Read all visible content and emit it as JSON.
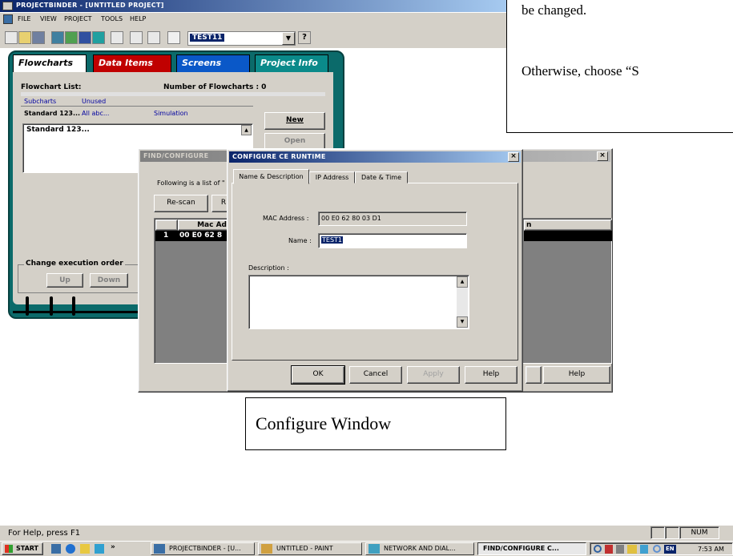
{
  "app": {
    "title": "ProjectBinder - [Untitled Project]",
    "menu": [
      "File",
      "View",
      "Project",
      "Tools",
      "Help"
    ],
    "toolbar_combo_value": "TEST11",
    "help_hint": "For Help, press F1",
    "status_num": "NUM"
  },
  "binder": {
    "tabs": [
      "Flowcharts",
      "Data Items",
      "Screens",
      "Project Info"
    ],
    "flowchart_list_label": "Flowchart List:",
    "number_label": "Number of Flowcharts : 0",
    "subtabs_row1": [
      "Subcharts",
      "Unused"
    ],
    "subtabs_row2": [
      "Standard 123...",
      "All abc...",
      "Simulation"
    ],
    "list_item": "Standard 123...",
    "new_label": "New",
    "open_label": "Open",
    "change_order_label": "Change execution order",
    "up_label": "Up",
    "down_label": "Down"
  },
  "find_dialog": {
    "title": "Find/Configure",
    "intro": "Following is a list of \"",
    "rescan_label": "Re-scan",
    "second_btn_label": "R",
    "col_mac": "Mac Ad",
    "col_n": "n",
    "row_num": "1",
    "row_mac": "00 E0 62 8",
    "help_label": "Help"
  },
  "config_dialog": {
    "title": "Configure CE Runtime",
    "tabs": [
      "Name & Description",
      "IP Address",
      "Date & Time"
    ],
    "mac_label": "MAC Address :",
    "mac_value": "00 E0 62 80 03 D1",
    "name_label": "Name :",
    "name_value": "TEST1",
    "description_label": "Description :",
    "ok_label": "OK",
    "cancel_label": "Cancel",
    "apply_label": "Apply",
    "help_label": "Help"
  },
  "callouts": {
    "top_line1": "be changed.",
    "top_line2": "Otherwise, choose “S",
    "configure_window": "Configure Window"
  },
  "taskbar": {
    "start_label": "Start",
    "items": [
      "ProjectBinder - [U...",
      "untitled - Paint",
      "Network and Dial...",
      "Find/Configure C..."
    ],
    "lang": "EN",
    "clock": "7:53 AM"
  },
  "colors": {
    "titlebar": "#0a246a",
    "binder_teal": "#0b6a6a",
    "tab_red": "#c00000",
    "tab_blue": "#0a58c8",
    "tab_green": "#0a8a8a"
  }
}
